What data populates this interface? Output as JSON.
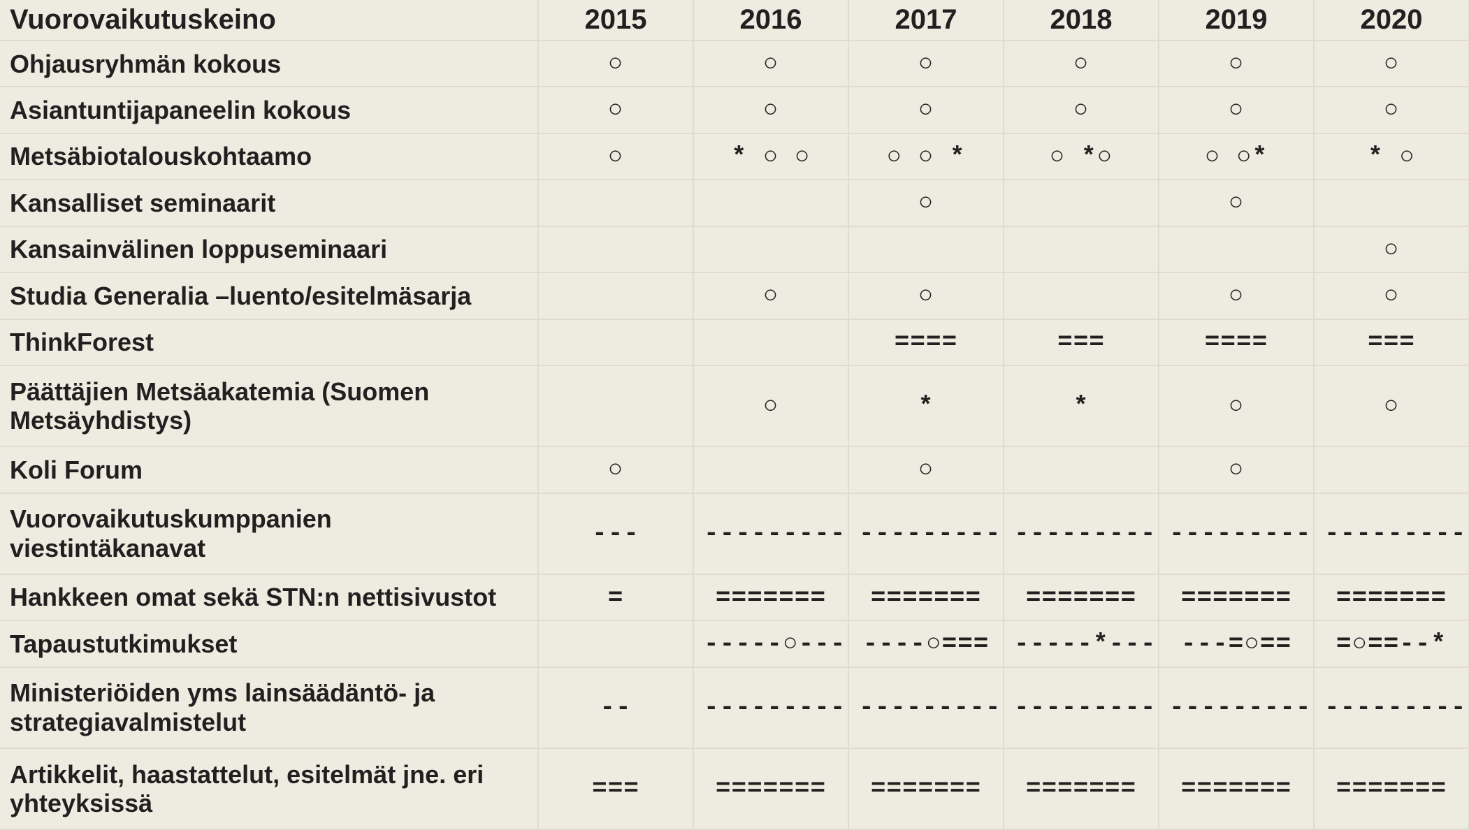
{
  "table": {
    "header": {
      "label": "Vuorovaikutuskeino",
      "years": [
        "2015",
        "2016",
        "2017",
        "2018",
        "2019",
        "2020"
      ]
    },
    "rows": [
      {
        "label": "Ohjausryhmän kokous",
        "cells": [
          "○",
          "○",
          "○",
          "○",
          "○",
          "○"
        ]
      },
      {
        "label": "Asiantuntijapaneelin kokous",
        "cells": [
          "○",
          "○",
          "○",
          "○",
          "○",
          "○"
        ]
      },
      {
        "label": "Metsäbiotalouskohtaamo",
        "cells": [
          "○",
          "*  ○   ○",
          "○  ○ *",
          "○  *○",
          "○   ○*",
          "*   ○"
        ]
      },
      {
        "label": "Kansalliset seminaarit",
        "cells": [
          "",
          "",
          "○",
          "",
          "○",
          ""
        ]
      },
      {
        "label": "Kansainvälinen loppuseminaari",
        "cells": [
          "",
          "",
          "",
          "",
          "",
          "○"
        ]
      },
      {
        "label": "Studia Generalia –luento/esitelmäsarja",
        "cells": [
          "",
          "○",
          "○",
          "",
          "○",
          "○"
        ]
      },
      {
        "label": "ThinkForest",
        "cells": [
          "",
          "",
          "====",
          "===",
          "====",
          "==="
        ]
      },
      {
        "label": "Päättäjien Metsäakatemia (Suomen Metsäyhdistys)",
        "cells": [
          "",
          "○",
          "*",
          "*",
          "○",
          "○"
        ]
      },
      {
        "label": "Koli Forum",
        "cells": [
          "○",
          "",
          "○",
          "",
          "○",
          ""
        ]
      },
      {
        "label": "Vuorovaikutuskumppanien viestintäkanavat",
        "cells": [
          "---",
          "-----------",
          "-----------",
          "-----------",
          "-----------",
          "-----------"
        ]
      },
      {
        "label": "Hankkeen omat sekä STN:n nettisivustot",
        "cells": [
          "=",
          "=======",
          "=======",
          "=======",
          "=======",
          "======="
        ]
      },
      {
        "label": "Tapaustutkimukset",
        "cells": [
          "",
          "-----○----",
          "----○===",
          "-----*----",
          "---=○==",
          "=○==--*"
        ]
      },
      {
        "label": "Ministeriöiden yms lainsäädäntö- ja strategiavalmistelut",
        "cells": [
          "--",
          "-----------",
          "-----------",
          "-----------",
          "-----------",
          "-----------"
        ]
      },
      {
        "label": "Artikkelit, haastattelut, esitelmät jne. eri yhteyksissä",
        "cells": [
          "===",
          "=======",
          "=======",
          "=======",
          "=======",
          "======="
        ]
      }
    ]
  }
}
